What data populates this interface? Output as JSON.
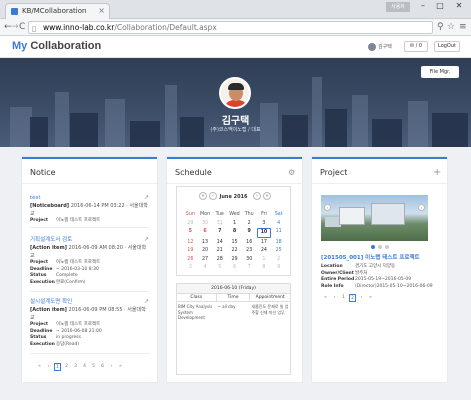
{
  "browser": {
    "tab_title": "KB/MCollaboration",
    "tab_close": "×",
    "window_user": "사용자",
    "min": "–",
    "max": "□",
    "close": "✕",
    "back": "←",
    "forward": "→",
    "reload": "C",
    "url_host": "www.inno-lab.co.kr",
    "url_path": "/Collaboration/Default.aspx",
    "zoom_icon": "⚲",
    "star": "☆",
    "menu": "≡"
  },
  "app": {
    "brand_my": "My",
    "brand_rest": " Collaboration",
    "user_name": "김구택",
    "mail_label": "✉ / 0",
    "logout": "LogOut"
  },
  "hero": {
    "file_mgr": "File Mgr.",
    "name": "김구택",
    "org": "(주)코스맥이노랩 / 대표"
  },
  "notice": {
    "title": "Notice",
    "items": [
      {
        "title": "test",
        "tag": "[Noticeboard]",
        "meta": "2016-06-14 PM 03:22 · 서울대학교",
        "rows": [
          [
            "Project",
            "이노랩 테스트 프로젝트"
          ]
        ]
      },
      {
        "title": "기획설계도서 검토",
        "tag": "[Action item]",
        "meta": "2016-06-09 AM 08:20 · 서울대학교",
        "rows": [
          [
            "Project",
            "이노랩 테스트 프로젝트"
          ],
          [
            "Deadline",
            "~ 2016-03-10 8:30"
          ],
          [
            "Status",
            "Complete"
          ],
          [
            "Execution",
            "완료(Confirm)"
          ]
        ]
      },
      {
        "title": "설시설계도면 확인",
        "tag": "[Action item]",
        "meta": "2016-06-09 PM 08:55 · 서울대학교",
        "rows": [
          [
            "Project",
            "이노랩 테스트 프로젝트"
          ],
          [
            "Deadline",
            "~ 2016-06-08 21:00"
          ],
          [
            "Status",
            "in progress"
          ],
          [
            "Execution",
            "응답(Read)"
          ]
        ]
      }
    ],
    "pager": [
      "«",
      "‹",
      "1",
      "2",
      "3",
      "4",
      "5",
      "6",
      "›",
      "»"
    ]
  },
  "schedule": {
    "title": "Schedule",
    "gear": "⚙",
    "month": "June 2016",
    "prev2": "«",
    "prev": "‹",
    "next": "›",
    "next2": "»",
    "dow": [
      "Sun",
      "Mon",
      "Tue",
      "Wed",
      "Thu",
      "Fri",
      "Sat"
    ],
    "weeks": [
      [
        "29",
        "30",
        "31",
        "1",
        "2",
        "3",
        "4"
      ],
      [
        "5",
        "6",
        "7",
        "8",
        "9",
        "10",
        "11"
      ],
      [
        "12",
        "13",
        "14",
        "15",
        "16",
        "17",
        "18"
      ],
      [
        "19",
        "20",
        "21",
        "22",
        "23",
        "24",
        "25"
      ],
      [
        "26",
        "27",
        "28",
        "29",
        "30",
        "1",
        "2"
      ],
      [
        "3",
        "4",
        "5",
        "6",
        "7",
        "8",
        "9"
      ]
    ],
    "day_title": "2016-06-10 (Friday)",
    "cols": [
      "Class",
      "Time",
      "Appointment"
    ],
    "entry": {
      "class": "BIM City Analysis System Development",
      "time": "~ all day",
      "appointment": "새롭진도 문제로 빌 업주할 신재 미선 업무"
    }
  },
  "project": {
    "title": "Project",
    "plus": "+",
    "name": "[201505_001] 이노랩 테스트 프로젝트",
    "rows": [
      [
        "Location",
        "경기도 고양시 덕양동"
      ],
      [
        "Owner/Client",
        "발주처"
      ],
      [
        "Entire Period",
        "2015-05-19~2016-05-09"
      ],
      [
        "Role Info",
        "(Director)2015-05-10~2016-06-09"
      ]
    ],
    "pager": [
      "«",
      "‹",
      "1",
      "2",
      "›",
      "»"
    ]
  }
}
